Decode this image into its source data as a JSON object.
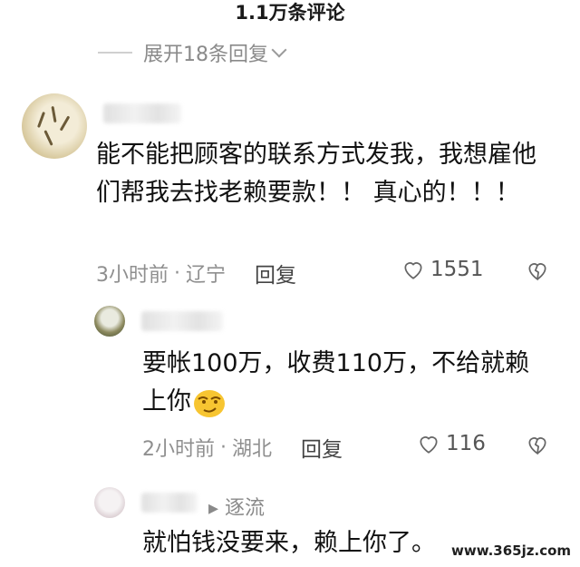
{
  "header": {
    "title": "1.1万条评论"
  },
  "expand_replies": {
    "label": "展开18条回复"
  },
  "main_comment": {
    "text": "能不能把顾客的联系方式发我，我想雇他们帮我去找老赖要款！！ 真心的！！！",
    "time": "3小时前",
    "separator": "·",
    "location": "辽宁",
    "reply_label": "回复",
    "likes": "1551"
  },
  "reply_1": {
    "text": "要帐100万，收费110万，不给就赖上你",
    "time": "2小时前",
    "separator": "·",
    "location": "湖北",
    "reply_label": "回复",
    "likes": "116",
    "emoji": "smirk-emoji"
  },
  "reply_2": {
    "reply_to": "逐流",
    "text": "就怕钱没要来，赖上你了。"
  },
  "watermark": "www.365jz.com",
  "icons": [
    "chevron-down-icon",
    "heart-icon",
    "broken-heart-icon"
  ],
  "colors": {
    "meta": "#8f8f8f",
    "text": "#111111",
    "emoji": "#f7c531"
  }
}
